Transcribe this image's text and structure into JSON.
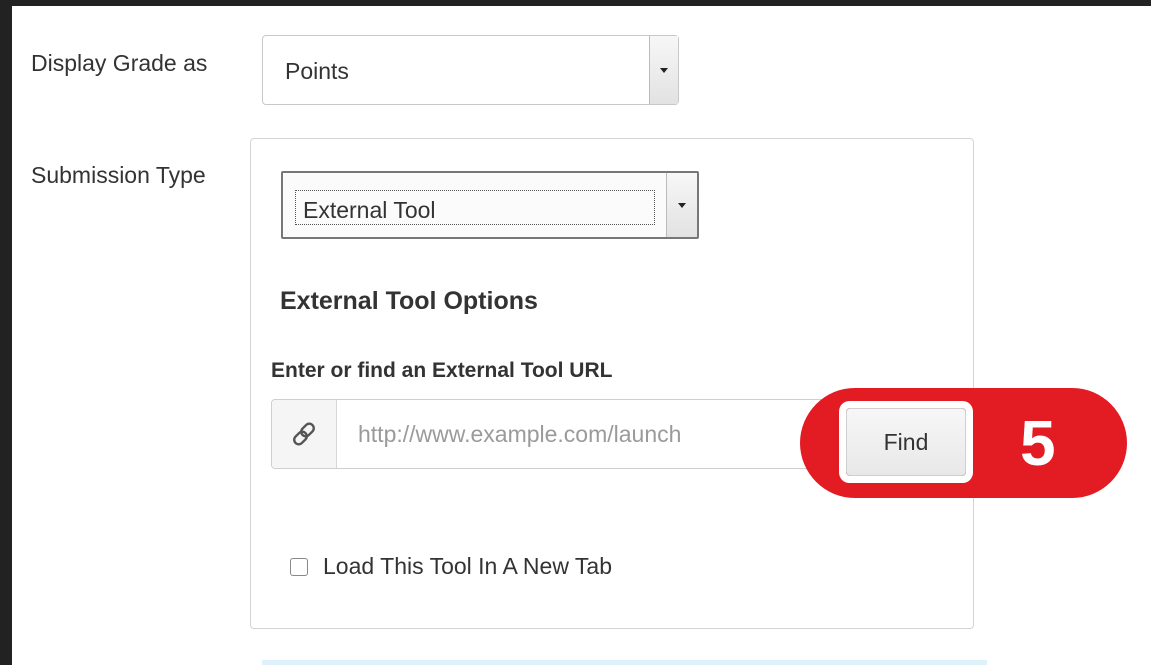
{
  "display_grade": {
    "label": "Display Grade as",
    "selected": "Points"
  },
  "submission": {
    "label": "Submission Type",
    "selected": "External Tool",
    "options_heading": "External Tool Options",
    "url_label": "Enter or find an External Tool URL",
    "url_value": "",
    "url_placeholder": "http://www.example.com/launch",
    "link_icon": "link-icon",
    "find_label": "Find",
    "new_tab_label": "Load This Tool In A New Tab",
    "new_tab_checked": false
  },
  "annotation": {
    "number": "5",
    "color": "#e31b23"
  }
}
